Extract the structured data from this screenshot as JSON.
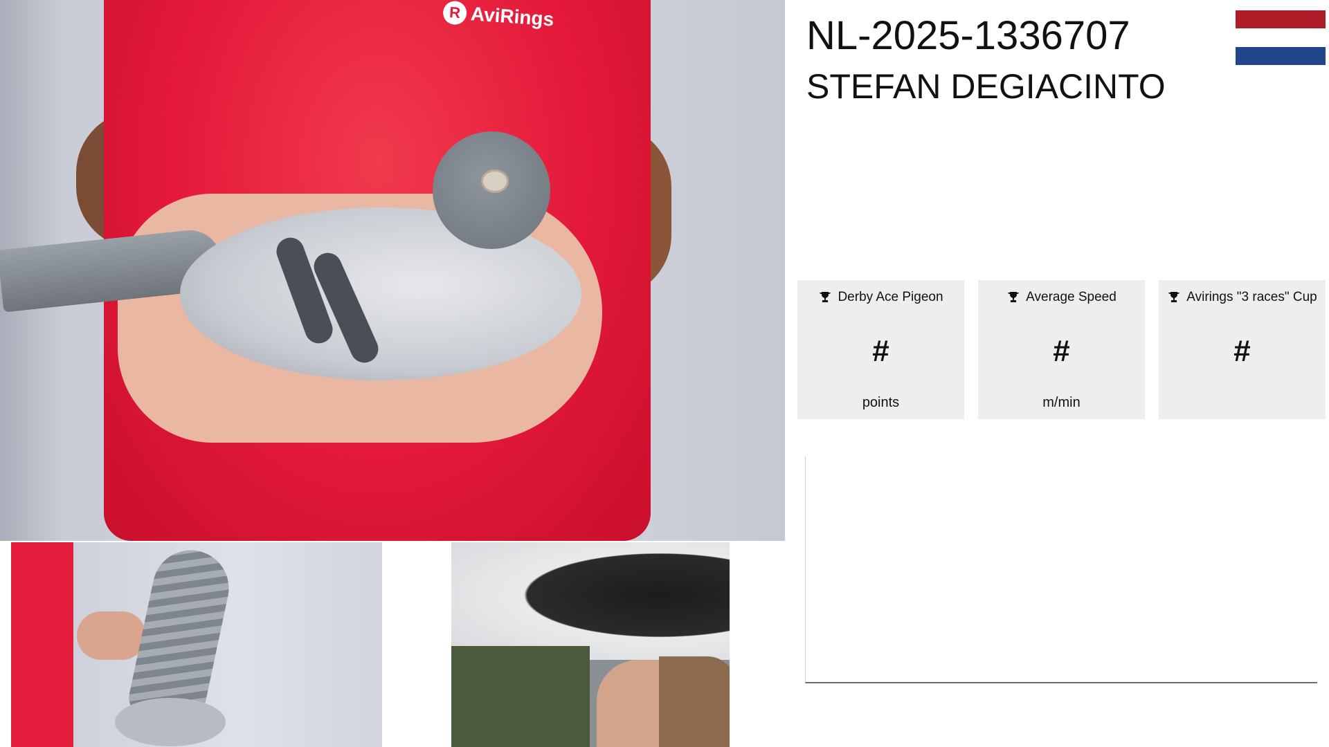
{
  "header": {
    "ring_number": "NL-2025-1336707",
    "owner_name": "STEFAN DEGIACINTO",
    "flag": {
      "country": "Netherlands",
      "colors": [
        "#AE1C28",
        "#FFFFFF",
        "#21468B"
      ]
    }
  },
  "photos": {
    "main_logo_text": "AviRings"
  },
  "stats": [
    {
      "title": "Derby Ace Pigeon",
      "value": "#",
      "unit": "points",
      "icon": "trophy-icon"
    },
    {
      "title": "Average Speed",
      "value": "#",
      "unit": "m/min",
      "icon": "trophy-icon"
    },
    {
      "title": "Avirings \"3 races\" Cup",
      "value": "#",
      "unit": "",
      "icon": "trophy-icon"
    }
  ],
  "theme": {
    "card_background": "#eeeeee",
    "shirt_red": "#e3183a"
  }
}
